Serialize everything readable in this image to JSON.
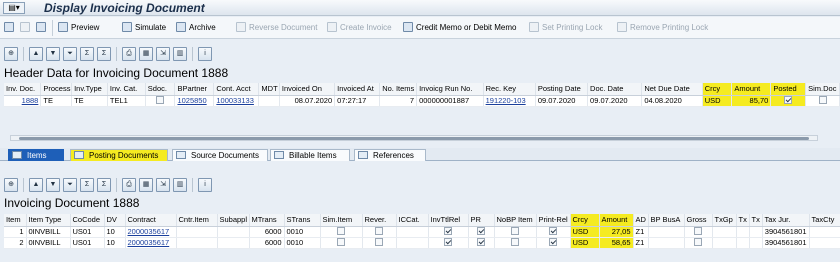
{
  "window": {
    "title": "Display Invoicing Document"
  },
  "app_toolbar": {
    "preview": "Preview",
    "simulate": "Simulate",
    "archive": "Archive",
    "reverse": "Reverse Document",
    "create_invoice": "Create Invoice",
    "credit_memo": "Credit Memo or Debit Memo",
    "set_lock": "Set Printing Lock",
    "remove_lock": "Remove Printing Lock"
  },
  "header": {
    "title": "Header Data for Invoicing Document 1888",
    "columns": [
      "Inv. Doc.",
      "Process",
      "Inv.Type",
      "Inv. Cat.",
      "Sdoc.",
      "BPartner",
      "Cont. Acct",
      "MDT",
      "Invoiced On",
      "Invoiced At",
      "No. Items",
      "Invoicg Run No.",
      "Rec. Key",
      "Posting Date",
      "Doc. Date",
      "Net Due Date",
      "Crcy",
      "Amount",
      "Posted",
      "Sim.Doc"
    ],
    "row": {
      "inv_doc": "1888",
      "process": "TE",
      "inv_type": "TE",
      "inv_cat": "TEL1",
      "sdoc": false,
      "bpartner": "1025850",
      "cont_acct": "100033133",
      "mdt": "",
      "invoiced_on": "08.07.2020",
      "invoiced_at": "07:27:17",
      "no_items": "7",
      "run_no": "000000001887",
      "rec_key": "191220-103",
      "posting_date": "09.07.2020",
      "doc_date": "09.07.2020",
      "net_due_date": "04.08.2020",
      "crcy": "USD",
      "amount": "85,70",
      "posted": true,
      "sim_doc": false
    }
  },
  "tabs": [
    "Items",
    "Posting Documents",
    "Source Documents",
    "Billable Items",
    "References"
  ],
  "items": {
    "title": "Invoicing Document 1888",
    "columns": [
      "Item",
      "Item Type",
      "CoCode",
      "DV",
      "Contract",
      "Cntr.Item",
      "Subappl",
      "MTrans",
      "STrans",
      "Sim.Item",
      "Rever.",
      "ICCat.",
      "InvTtlRel",
      "PR",
      "NoBP Item",
      "Print-Rel",
      "Crcy",
      "Amount",
      "AD",
      "BP BusA",
      "Gross",
      "TxGp",
      "Tx",
      "Tx",
      "Tax Jur.",
      "TaxCty"
    ],
    "rows": [
      {
        "item": "1",
        "type": "0INVBILL",
        "cocode": "US01",
        "dv": "10",
        "contract": "2000035617",
        "mtrans": "6000",
        "strans": "0010",
        "invttl": true,
        "pr": true,
        "print": true,
        "crcy": "USD",
        "amount": "27,05",
        "ad": "Z1",
        "taxjur": "3904561801"
      },
      {
        "item": "2",
        "type": "0INVBILL",
        "cocode": "US01",
        "dv": "10",
        "contract": "2000035617",
        "mtrans": "6000",
        "strans": "0010",
        "invttl": true,
        "pr": true,
        "print": true,
        "crcy": "USD",
        "amount": "58,65",
        "ad": "Z1",
        "taxjur": "3904561801"
      }
    ]
  }
}
